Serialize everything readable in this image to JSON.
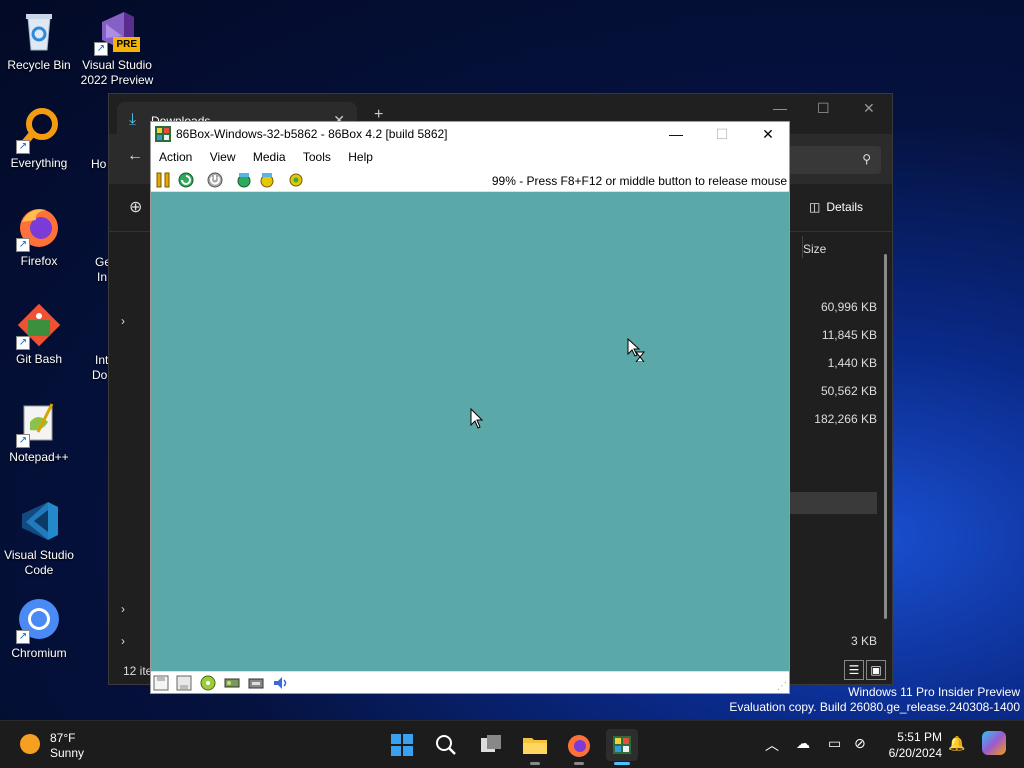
{
  "desktop": {
    "icons": [
      {
        "label": "Recycle Bin",
        "icon": "recycle-bin-icon"
      },
      {
        "label": "Visual Studio 2022 Preview",
        "icon": "visual-studio-icon",
        "badge": "PRE"
      },
      {
        "label": "Everything",
        "icon": "everything-search-icon"
      },
      {
        "label": "Firefox",
        "icon": "firefox-icon"
      },
      {
        "label": "Git Bash",
        "icon": "git-bash-icon"
      },
      {
        "label": "Notepad++",
        "icon": "notepadpp-icon"
      },
      {
        "label": "Visual Studio Code",
        "icon": "vscode-icon"
      },
      {
        "label": "Chromium",
        "icon": "chromium-icon"
      }
    ],
    "partial_labels": [
      "Ho",
      "Ge",
      "In",
      "Int",
      "Do"
    ]
  },
  "explorer": {
    "tab_title": "Downloads",
    "toolbar_details_label": "Details",
    "column_size_label": "Size",
    "sizes": [
      "60,996 KB",
      "11,845 KB",
      "1,440 KB",
      "50,562 KB",
      "182,266 KB",
      "3 KB"
    ],
    "status": "12 ite"
  },
  "box86": {
    "title": "86Box-Windows-32-b5862 - 86Box 4.2 [build 5862]",
    "menu": [
      "Action",
      "View",
      "Media",
      "Tools",
      "Help"
    ],
    "status_message": "99% - Press F8+F12 or middle button to release mouse",
    "screen_color": "#5ba8a8"
  },
  "watermark": {
    "line1": "Windows 11 Pro Insider Preview",
    "line2": "Evaluation copy. Build 26080.ge_release.240308-1400"
  },
  "taskbar": {
    "weather_temp": "87°F",
    "weather_desc": "Sunny",
    "time": "5:51 PM",
    "date": "6/20/2024"
  }
}
